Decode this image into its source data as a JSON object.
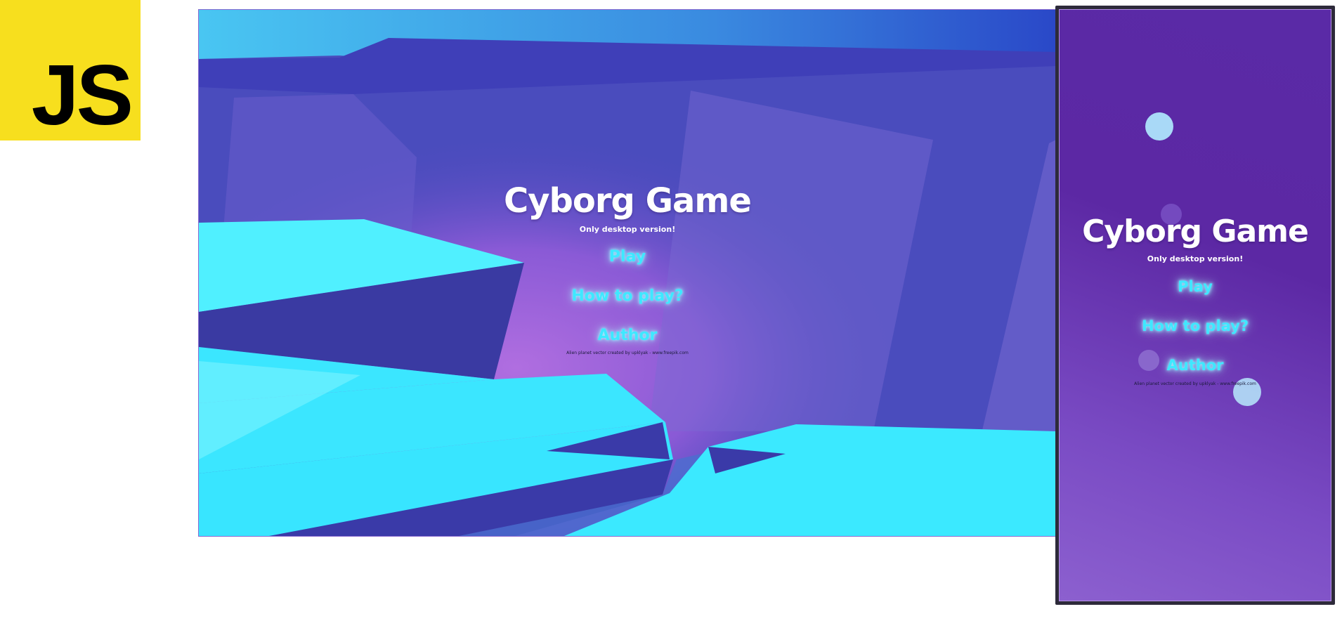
{
  "logo": {
    "text": "JS",
    "color": "#f7df1e"
  },
  "desktop_view": {
    "title": "Cyborg Game",
    "subtitle": "Only desktop version!",
    "menu": [
      {
        "label": "Play"
      },
      {
        "label": "How to play?"
      },
      {
        "label": "Author"
      }
    ],
    "credit": "Alien planet vector created by upklyak - www.freepik.com"
  },
  "mobile_view": {
    "title": "Cyborg Game",
    "subtitle": "Only desktop version!",
    "menu": [
      {
        "label": "Play"
      },
      {
        "label": "How to play?"
      },
      {
        "label": "Author"
      }
    ],
    "credit": "Alien planet vector created by upklyak - www.freepik.com"
  },
  "colors": {
    "menu_glow": "#3ee8ff",
    "title": "#ffffff",
    "mobile_bg": "#5c28a4",
    "desktop_bg": "#4b4bbd",
    "crystal": "#3be6ff"
  }
}
